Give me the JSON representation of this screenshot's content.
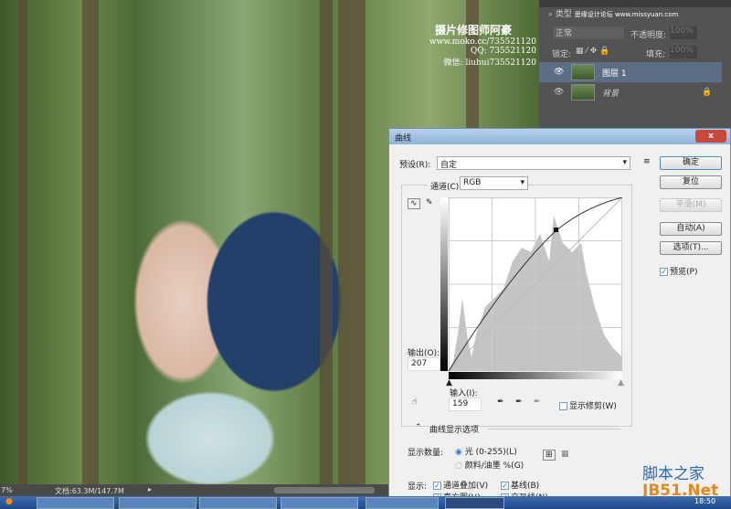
{
  "watermark": {
    "title": "摄片修图师阿豪",
    "url": "www.moko.cc/735521120",
    "qq": "QQ: 735521120",
    "wechat": "微信: liuhui735521120"
  },
  "layers_panel": {
    "search": "类型",
    "site_mark": "思缘设计论坛 www.missyuan.com",
    "blend_mode": "正常",
    "opacity_label": "不透明度:",
    "opacity": "100%",
    "lock_label": "锁定:",
    "fill_label": "填充:",
    "fill": "100%",
    "layers": [
      {
        "name": "图层 1",
        "selected": true
      },
      {
        "name": "背景",
        "locked": true
      }
    ]
  },
  "dialog": {
    "title": "曲线",
    "close": "x",
    "preset_label": "预设(R):",
    "preset_value": "自定",
    "channel_label": "通道(C):",
    "channel_value": "RGB",
    "output_label": "输出(O):",
    "output_value": "207",
    "input_label": "输入(I):",
    "input_value": "159",
    "show_clipping": "显示修剪(W)",
    "display_options": "曲线显示选项",
    "show_amount_label": "显示数量:",
    "light_option": "光 (0-255)(L)",
    "pigment_option": "颜料/油墨 %(G)",
    "show_label": "显示:",
    "channel_overlay": "通道叠加(V)",
    "baseline": "基线(B)",
    "histogram": "直方图(H)",
    "intersection": "交叉线(N)",
    "buttons": {
      "ok": "确定",
      "reset": "复位",
      "smooth": "平滑(M)",
      "auto": "自动(A)",
      "options": "选项(T)..."
    },
    "preview": "预览(P)"
  },
  "status_bar": {
    "zoom": "7%",
    "doc": "文档:63.3M/147.7M"
  },
  "taskbar": {
    "clock": "18:50"
  },
  "site_logo": {
    "cn": "脚本之家",
    "en": "JB51.Net"
  }
}
